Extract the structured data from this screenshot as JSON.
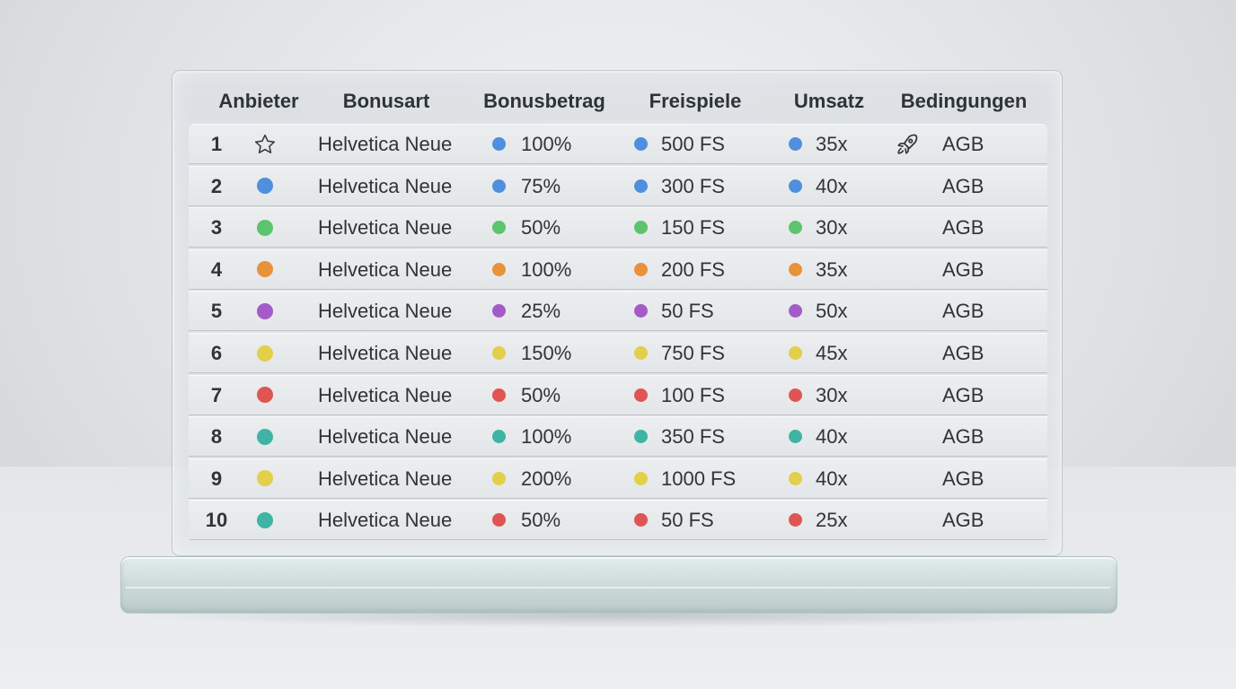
{
  "header": {
    "columns": [
      "Anbieter",
      "Bonusart",
      "Bonusbetrag",
      "Freispiele",
      "Umsatz",
      "Bedingungen"
    ]
  },
  "colors": {
    "blue": "#4f8fdd",
    "green": "#5cc46c",
    "orange": "#e8923a",
    "purple": "#a45bc8",
    "yellow": "#e2cf4a",
    "red": "#e05454",
    "teal": "#3fb4a4"
  },
  "rows": [
    {
      "rank": "1",
      "marker": "star-icon",
      "provider": "Helvetica Neue",
      "bonus": "100%",
      "bonus_color": "blue",
      "spins": "500 FS",
      "spins_color": "blue",
      "wager": "35x",
      "wager_color": "blue",
      "terms_icon": "rocket-icon",
      "terms": "AGB"
    },
    {
      "rank": "2",
      "marker": "blue",
      "provider": "Helvetica Neue",
      "bonus": "75%",
      "bonus_color": "blue",
      "spins": "300 FS",
      "spins_color": "blue",
      "wager": "40x",
      "wager_color": "blue",
      "terms": "AGB"
    },
    {
      "rank": "3",
      "marker": "green",
      "provider": "Helvetica Neue",
      "bonus": "50%",
      "bonus_color": "green",
      "spins": "150 FS",
      "spins_color": "green",
      "wager": "30x",
      "wager_color": "green",
      "terms": "AGB"
    },
    {
      "rank": "4",
      "marker": "orange",
      "provider": "Helvetica Neue",
      "bonus": "100%",
      "bonus_color": "orange",
      "spins": "200 FS",
      "spins_color": "orange",
      "wager": "35x",
      "wager_color": "orange",
      "terms": "AGB"
    },
    {
      "rank": "5",
      "marker": "purple",
      "provider": "Helvetica Neue",
      "bonus": "25%",
      "bonus_color": "purple",
      "spins": "50 FS",
      "spins_color": "purple",
      "wager": "50x",
      "wager_color": "purple",
      "terms": "AGB"
    },
    {
      "rank": "6",
      "marker": "yellow",
      "provider": "Helvetica Neue",
      "bonus": "150%",
      "bonus_color": "yellow",
      "spins": "750 FS",
      "spins_color": "yellow",
      "wager": "45x",
      "wager_color": "yellow",
      "terms": "AGB"
    },
    {
      "rank": "7",
      "marker": "red",
      "provider": "Helvetica Neue",
      "bonus": "50%",
      "bonus_color": "red",
      "spins": "100 FS",
      "spins_color": "red",
      "wager": "30x",
      "wager_color": "red",
      "terms": "AGB"
    },
    {
      "rank": "8",
      "marker": "teal",
      "provider": "Helvetica Neue",
      "bonus": "100%",
      "bonus_color": "teal",
      "spins": "350 FS",
      "spins_color": "teal",
      "wager": "40x",
      "wager_color": "teal",
      "terms": "AGB"
    },
    {
      "rank": "9",
      "marker": "yellow",
      "provider": "Helvetica Neue",
      "bonus": "200%",
      "bonus_color": "yellow",
      "spins": "1000 FS",
      "spins_color": "yellow",
      "wager": "40x",
      "wager_color": "yellow",
      "terms": "AGB"
    },
    {
      "rank": "10",
      "marker": "teal",
      "provider": "Helvetica Neue",
      "bonus": "50%",
      "bonus_color": "red",
      "spins": "50 FS",
      "spins_color": "red",
      "wager": "25x",
      "wager_color": "red",
      "terms": "AGB"
    }
  ]
}
